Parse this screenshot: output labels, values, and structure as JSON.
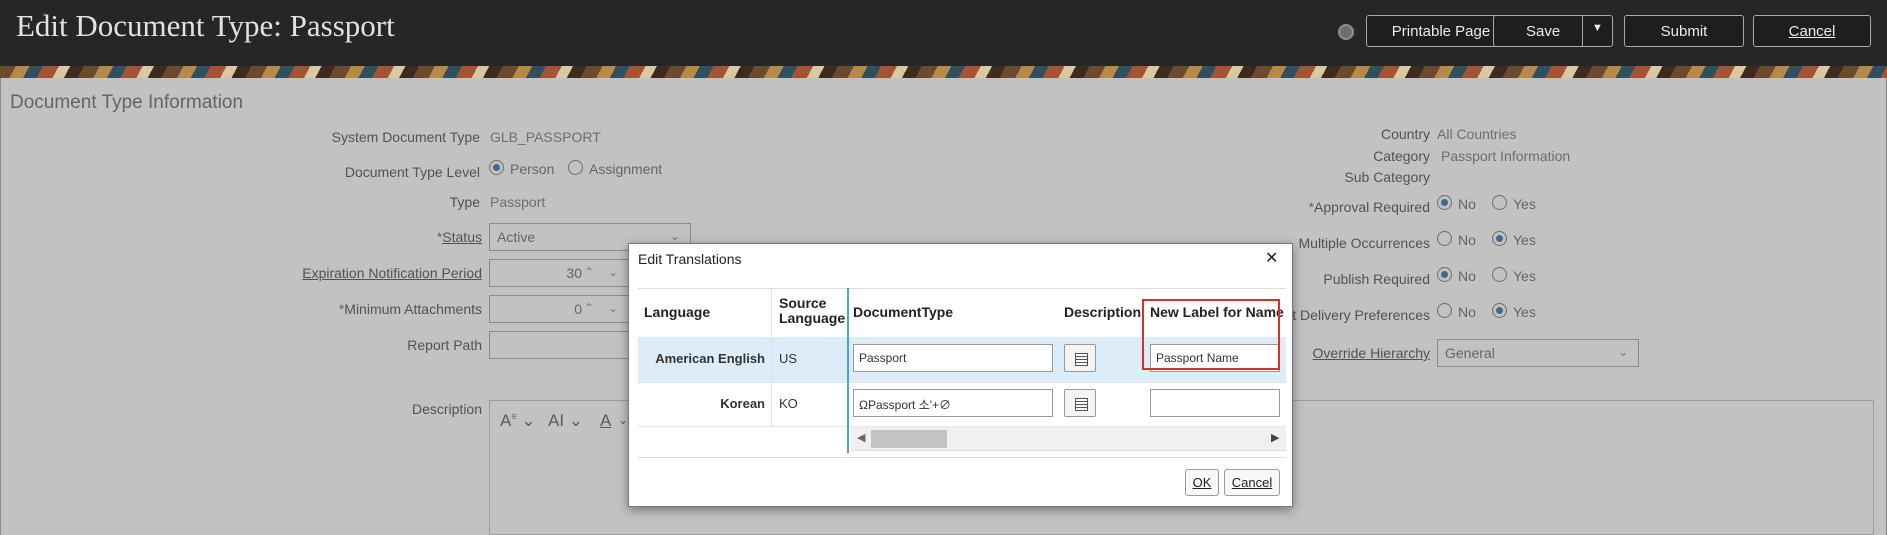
{
  "header": {
    "title": "Edit Document Type: Passport",
    "printable_label": "Printable Page",
    "save_label": "Save",
    "submit_label": "Submit",
    "cancel_label": "Cancel"
  },
  "section": {
    "title": "Document Type Information"
  },
  "left_form": {
    "system_type_label": "System Document Type",
    "system_type_value": "GLB_PASSPORT",
    "level_label": "Document Type Level",
    "level_options": [
      "Person",
      "Assignment"
    ],
    "level_selected": "Person",
    "type_label": "Type",
    "type_value": "Passport",
    "status_label": "Status",
    "status_value": "Active",
    "expiration_label": "Expiration Notification Period",
    "expiration_value": "30",
    "min_attach_label": "Minimum Attachments",
    "min_attach_value": "0",
    "report_path_label": "Report Path",
    "report_path_value": "",
    "description_label": "Description"
  },
  "right_form": {
    "country_label": "Country",
    "country_value": "All Countries",
    "category_label": "Category",
    "category_value": "Passport Information",
    "subcategory_label": "Sub Category",
    "subcategory_value": "",
    "approval_label": "Approval Required",
    "approval_selected": "No",
    "multiple_label": "Multiple Occurrences",
    "multiple_selected": "Yes",
    "publish_label": "Publish Required",
    "publish_selected": "No",
    "delivery_label": "t Delivery Preferences",
    "delivery_selected": "Yes",
    "override_label": "Override Hierarchy",
    "override_value": "General",
    "no_label": "No",
    "yes_label": "Yes"
  },
  "dialog": {
    "title": "Edit Translations",
    "columns": [
      "Language",
      "Source Language",
      "DocumentType",
      "Description",
      "New Label for Name"
    ],
    "rows": [
      {
        "language": "American English",
        "source": "US",
        "document_type": "Passport",
        "new_label": "Passport Name"
      },
      {
        "language": "Korean",
        "source": "KO",
        "document_type": "ΩPassport 소'+∅",
        "new_label": ""
      }
    ],
    "ok_label": "OK",
    "cancel_label": "Cancel"
  },
  "colors": {
    "header_bg": "#262626",
    "accent": "#1a5b9e",
    "highlight_box": "#d93025",
    "selected_row": "#dcecf8"
  }
}
